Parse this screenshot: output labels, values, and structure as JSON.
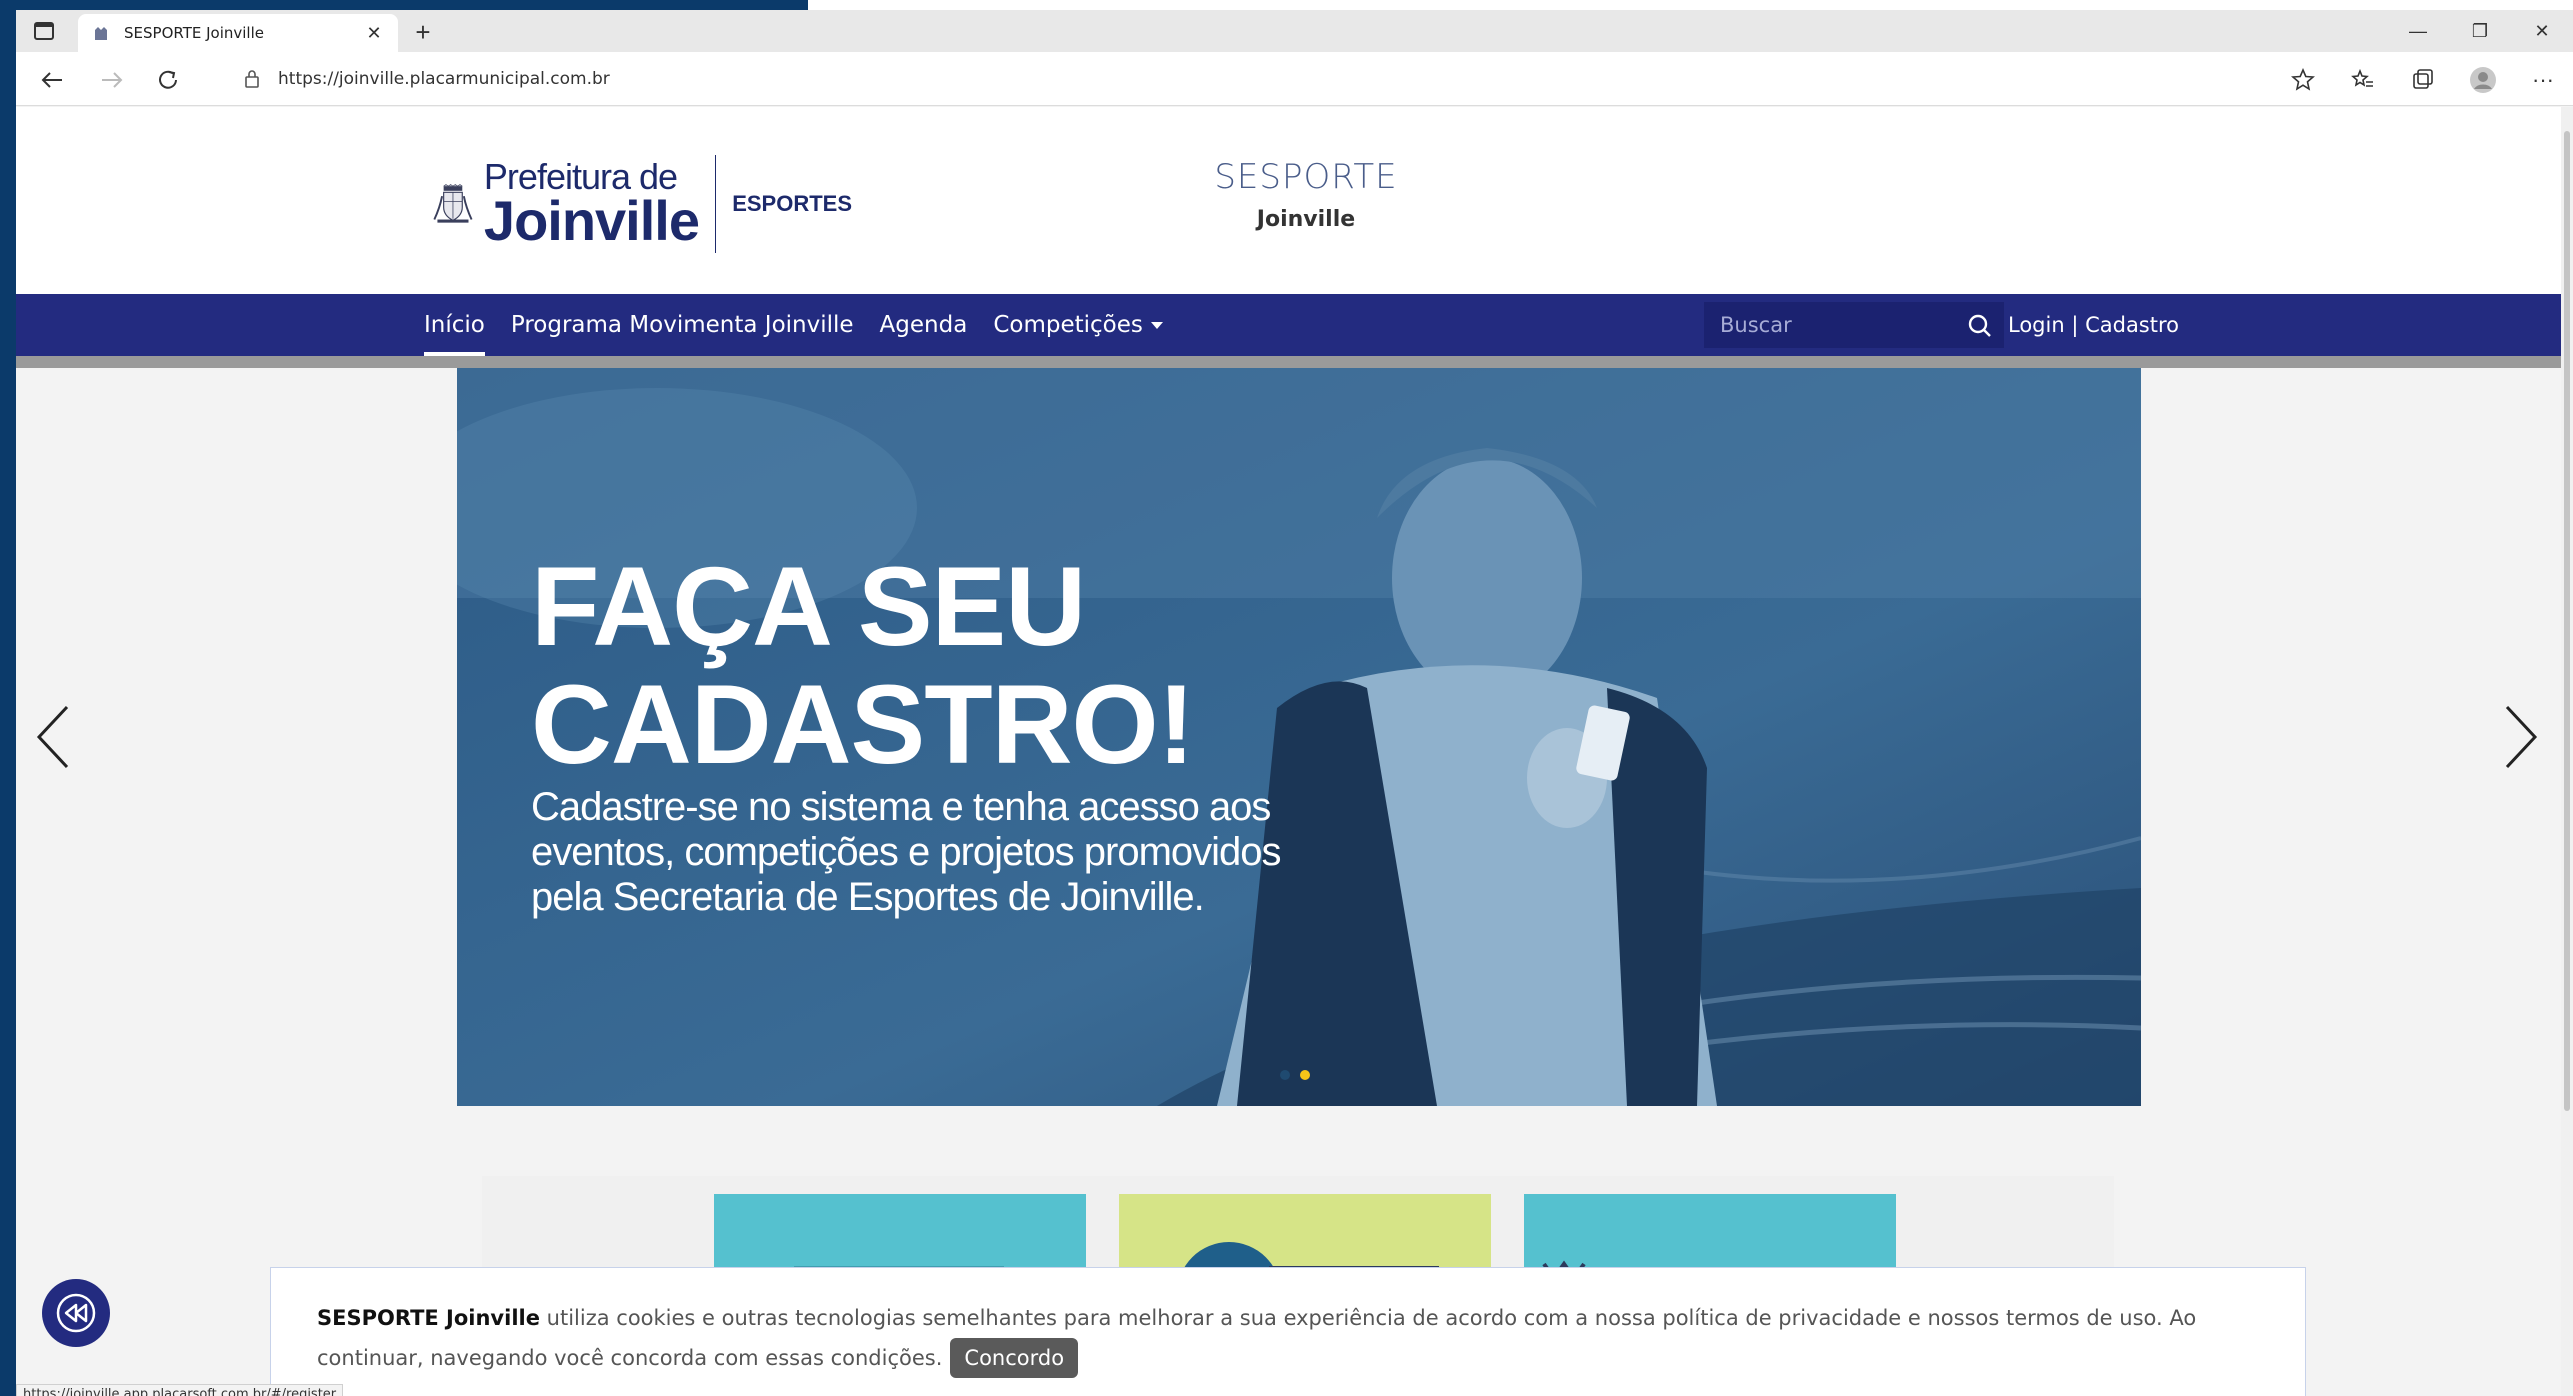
{
  "browser": {
    "tab_title": "SESPORTE Joinville",
    "url": "https://joinville.placarmunicipal.com.br",
    "status_url": "https://joinville.app.placarsoft.com.br/#/register"
  },
  "header": {
    "logo": {
      "line1": "Prefeitura de",
      "line2": "Joinville",
      "dept": "ESPORTES"
    },
    "brand_name": "SESPORTE",
    "brand_sub": "Joinville"
  },
  "nav": {
    "items": [
      {
        "label": "Início",
        "active": true
      },
      {
        "label": "Programa Movimenta Joinville"
      },
      {
        "label": "Agenda"
      },
      {
        "label": "Competições",
        "dropdown": true
      }
    ],
    "search_placeholder": "Buscar",
    "login_label": "Login | Cadastro"
  },
  "hero": {
    "title_line1": "FAÇA SEU",
    "title_line2": "CADASTRO!",
    "text": "Cadastre-se no sistema e tenha acesso aos eventos, competições e projetos promovidos pela Secretaria de Esportes de Joinville.",
    "slides": 2,
    "active_slide": 2
  },
  "cookie": {
    "brand": "SESPORTE Joinville",
    "message": "utiliza cookies e outras tecnologias semelhantes para melhorar a sua experiência de acordo com a nossa política de privacidade e nossos termos de uso. Ao continuar, navegando você concorda com essas condições.",
    "agree_label": "Concordo"
  },
  "colors": {
    "nav_bg": "#232b80",
    "accent_dot": "#f5c518",
    "card1": "#55c1cf",
    "card2": "#d6e487",
    "card3": "#55c1cf"
  }
}
